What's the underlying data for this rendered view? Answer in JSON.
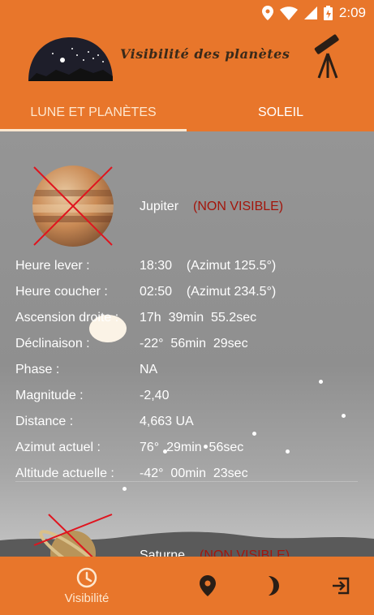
{
  "status_bar": {
    "time": "2:09",
    "icons": [
      "location-icon",
      "wifi-icon",
      "signal-icon",
      "battery-icon"
    ]
  },
  "app": {
    "title": "Visibilité des planètes"
  },
  "tabs": [
    {
      "label": "LUNE ET PLANÈTES",
      "active": true
    },
    {
      "label": "SOLEIL",
      "active": false
    }
  ],
  "planets": [
    {
      "name": "Jupiter",
      "status": "(NON VISIBLE)",
      "details": [
        {
          "label": "Heure lever :",
          "value": "18:30    (Azimut 125.5°)"
        },
        {
          "label": "Heure coucher :",
          "value": "02:50    (Azimut 234.5°)"
        },
        {
          "label": "Ascension droite :",
          "value": "17h  39min  55.2sec"
        },
        {
          "label": "Déclinaison :",
          "value": "-22°  56min  29sec"
        },
        {
          "label": "Phase :",
          "value": "NA"
        },
        {
          "label": "Magnitude :",
          "value": "-2,40"
        },
        {
          "label": "Distance :",
          "value": "4,663 UA"
        },
        {
          "label": "Azimut actuel :",
          "value": "76°  29min  56sec"
        },
        {
          "label": "Altitude actuelle :",
          "value": "-42°  00min  23sec"
        }
      ]
    },
    {
      "name": "Saturne",
      "status": "(NON VISIBLE)"
    }
  ],
  "bottom_nav": [
    {
      "icon": "clock-icon",
      "label": "Visibilité",
      "active": true
    },
    {
      "icon": "location-pin-icon",
      "label": "",
      "active": false
    },
    {
      "icon": "moon-icon",
      "label": "",
      "active": false
    },
    {
      "icon": "exit-icon",
      "label": "",
      "active": false
    }
  ],
  "colors": {
    "primary": "#e8762b",
    "accent_light": "#fde7cf",
    "status_not_visible": "#a3150b",
    "background": "#8f8f8f"
  }
}
